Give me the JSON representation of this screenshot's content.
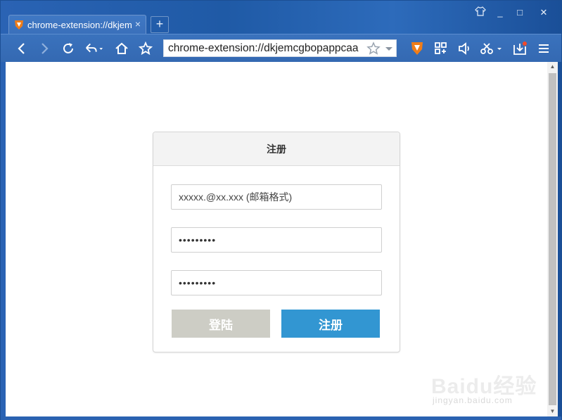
{
  "browser": {
    "tab": {
      "title": "chrome-extension://dkjemcgbopappcaa",
      "close": "×"
    },
    "new_tab": "+",
    "window_controls": {
      "skin": "skin-icon",
      "minimize": "_",
      "maximize": "□",
      "close": "✕"
    },
    "address": "chrome-extension://dkjemcgbopappcaa",
    "icons": [
      "back-icon",
      "forward-icon",
      "reload-icon",
      "undo-icon",
      "home-icon",
      "star-icon",
      "shield-icon",
      "apps-icon",
      "volume-icon",
      "scissors-icon",
      "download-icon",
      "menu-icon"
    ],
    "accent": "#2a63b4"
  },
  "form": {
    "title": "注册",
    "email_placeholder": "xxxxx.@xx.xxx (邮箱格式)",
    "password_value": "•••••••••",
    "confirm_value": "•••••••••",
    "login_label": "登陆",
    "register_label": "注册",
    "login_color": "#cdcdc5",
    "register_color": "#3296d2"
  },
  "watermark": {
    "brand": "Baidu经验",
    "url": "jingyan.baidu.com"
  }
}
